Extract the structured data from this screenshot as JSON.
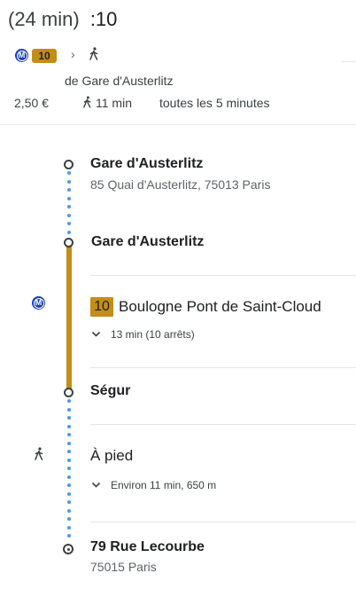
{
  "header": {
    "duration": "(24 min)",
    "arrival_time": ":10",
    "route_summary": {
      "metro_icon": "metro-icon",
      "metro_icon_glyph": "M",
      "line_number": "10",
      "separator": "›",
      "walk_icon": "walk-icon"
    },
    "departure_note": "de Gare d'Austerlitz",
    "fare": "2,50 €",
    "walk_time": "11 min",
    "frequency": "toutes les 5 minutes"
  },
  "itinerary": {
    "origin": {
      "name": "Gare d'Austerlitz",
      "address": "85 Quai d'Austerlitz, 75013 Paris"
    },
    "boarding_stop": {
      "name": "Gare d'Austerlitz"
    },
    "metro_leg": {
      "mode_icon": "metro-icon",
      "mode_icon_glyph": "M",
      "line_number": "10",
      "direction": "Boulogne Pont de Saint-Cloud",
      "detail": "13 min (10 arrêts)",
      "line_color": "#c48d17"
    },
    "alighting_stop": {
      "name": "Ségur"
    },
    "walk_leg": {
      "mode_icon": "walk-icon",
      "mode_icon_glyph": "🚶",
      "label": "À pied",
      "detail": "Environ 11 min, 650 m",
      "dot_color": "#4b9ae8"
    },
    "destination": {
      "name": "79 Rue Lecourbe",
      "address": "75015 Paris"
    }
  }
}
